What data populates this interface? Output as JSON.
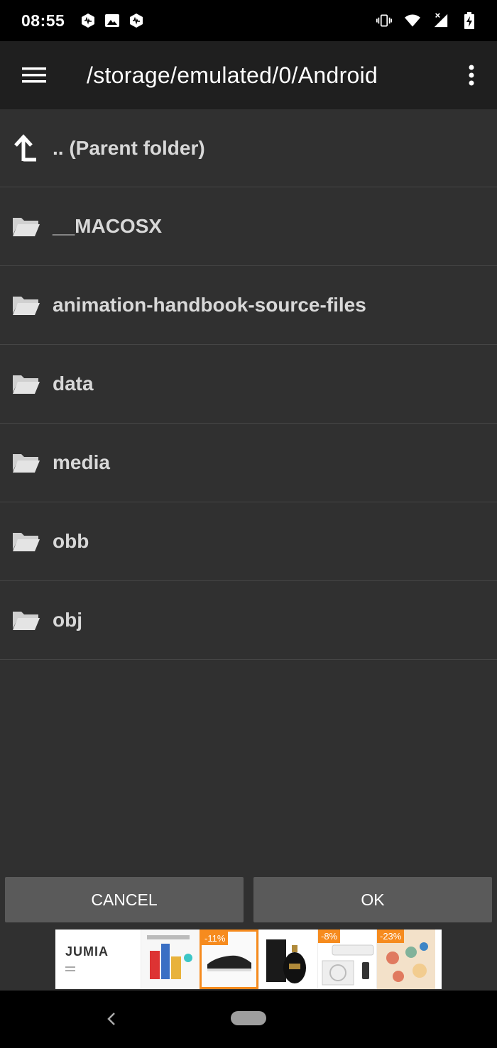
{
  "status_bar": {
    "time": "08:55",
    "left_icons": [
      "app-notification-icon",
      "image-icon",
      "app-notification-icon"
    ],
    "right_icons": [
      "vibrate-icon",
      "wifi-icon",
      "signal-icon",
      "battery-charging-icon"
    ]
  },
  "app_bar": {
    "menu_icon": "hamburger-menu-icon",
    "title": "/storage/emulated/0/Android",
    "overflow_icon": "more-vert-icon"
  },
  "list": {
    "parent": ".. (Parent folder)",
    "folders": [
      "__MACOSX",
      "animation-handbook-source-files",
      "data",
      "media",
      "obb",
      "obj"
    ]
  },
  "buttons": {
    "cancel": "CANCEL",
    "ok": "OK"
  },
  "ad": {
    "brand": "JUMIA",
    "tiles": [
      {
        "badge": ""
      },
      {
        "badge": "-11%"
      },
      {
        "badge": ""
      },
      {
        "badge": "-8%"
      },
      {
        "badge": "-23%"
      }
    ]
  },
  "nav_bar": {
    "back_icon": "back-icon",
    "home_icon": "home-pill-icon"
  },
  "colors": {
    "background": "#303030",
    "app_bar": "#1f1f1f",
    "button": "#5a5a5a",
    "ad_accent": "#f68b1e"
  }
}
